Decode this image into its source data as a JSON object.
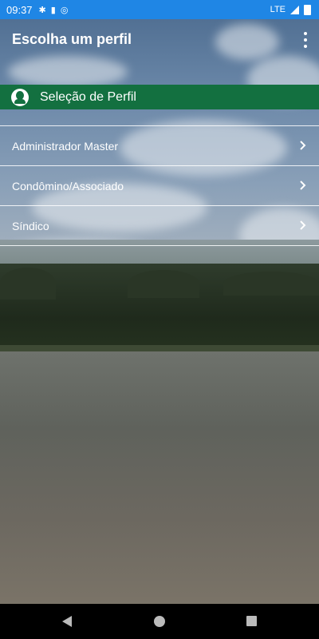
{
  "status_bar": {
    "time": "09:37",
    "network": "LTE",
    "color": "#1f86e5"
  },
  "app_bar": {
    "title": "Escolha um perfil",
    "menu_icon": "more-vert-icon"
  },
  "section": {
    "title": "Seleção de Perfil",
    "icon": "profile-icon",
    "color": "#137040"
  },
  "profiles": [
    {
      "label": "Administrador Master",
      "icon": "chevron-right-icon"
    },
    {
      "label": "Condômino/Associado",
      "icon": "chevron-right-icon"
    },
    {
      "label": "Síndico",
      "icon": "chevron-right-icon"
    }
  ],
  "nav_bar": {
    "back_icon": "back-icon",
    "home_icon": "home-icon",
    "recents_icon": "recents-icon"
  }
}
